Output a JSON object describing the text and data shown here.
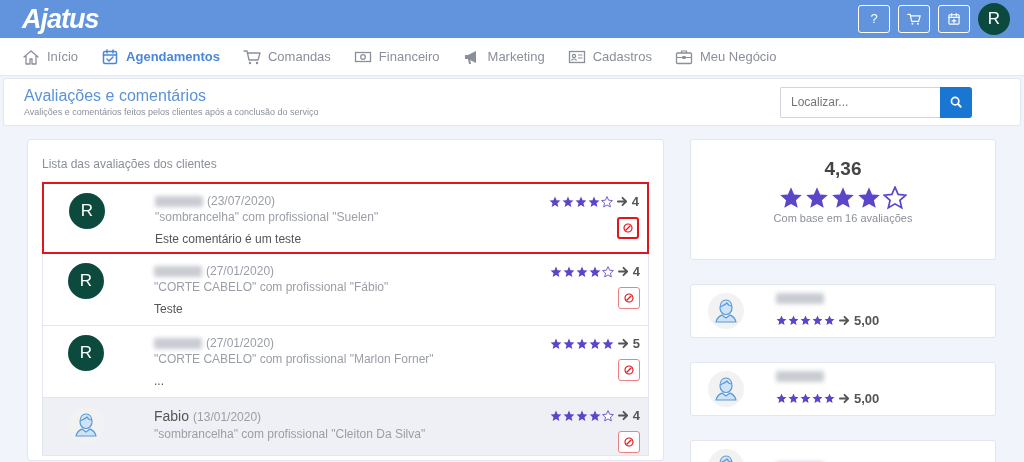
{
  "header": {
    "logo": "Ajatus",
    "help_label": "?",
    "avatar_letter": "R"
  },
  "nav": [
    {
      "label": "Início",
      "selected": false
    },
    {
      "label": "Agendamentos",
      "selected": true
    },
    {
      "label": "Comandas",
      "selected": false
    },
    {
      "label": "Financeiro",
      "selected": false
    },
    {
      "label": "Marketing",
      "selected": false
    },
    {
      "label": "Cadastros",
      "selected": false
    },
    {
      "label": "Meu Negócio",
      "selected": false
    }
  ],
  "page_header": {
    "title": "Avaliações e comentários",
    "subtitle": "Avalições e comentários feitos pelos clientes após a conclusão do serviço",
    "search": {
      "placeholder": "Localizar..."
    }
  },
  "reviews": {
    "title": "Lista das avaliações dos clientes",
    "items": [
      {
        "kind": "letter",
        "avatar_letter": "R",
        "date": "(23/07/2020)",
        "service": "\"sombrancelha\" com profissional \"Suelen\"",
        "comment": "Este comentário é um teste",
        "stars": 4,
        "score": "4",
        "highlighted": true,
        "selected": false
      },
      {
        "kind": "letter",
        "avatar_letter": "R",
        "date": "(27/01/2020)",
        "service": "\"CORTE CABELO\" com profissional \"Fábio\"",
        "comment": "Teste",
        "stars": 4,
        "score": "4",
        "highlighted": false,
        "selected": false
      },
      {
        "kind": "letter",
        "avatar_letter": "R",
        "date": "(27/01/2020)",
        "service": "\"CORTE CABELO\" com profissional \"Marlon Forner\"",
        "comment": "...",
        "stars": 5,
        "score": "5",
        "highlighted": false,
        "selected": false
      },
      {
        "kind": "user",
        "name": "Fabio",
        "date": "(13/01/2020)",
        "service": "\"sombrancelha\" com profissional \"Cleiton Da Silva\"",
        "stars": 4,
        "score": "4",
        "highlighted": false,
        "selected": true
      }
    ]
  },
  "summary": {
    "average": "4,36",
    "stars": 4,
    "caption": "Com base em 16 avaliações"
  },
  "professionals": [
    {
      "kind": "rated",
      "stars": 5,
      "score": "5,00"
    },
    {
      "kind": "rated",
      "stars": 5,
      "score": "5,00"
    },
    {
      "kind": "cut_off"
    }
  ]
}
